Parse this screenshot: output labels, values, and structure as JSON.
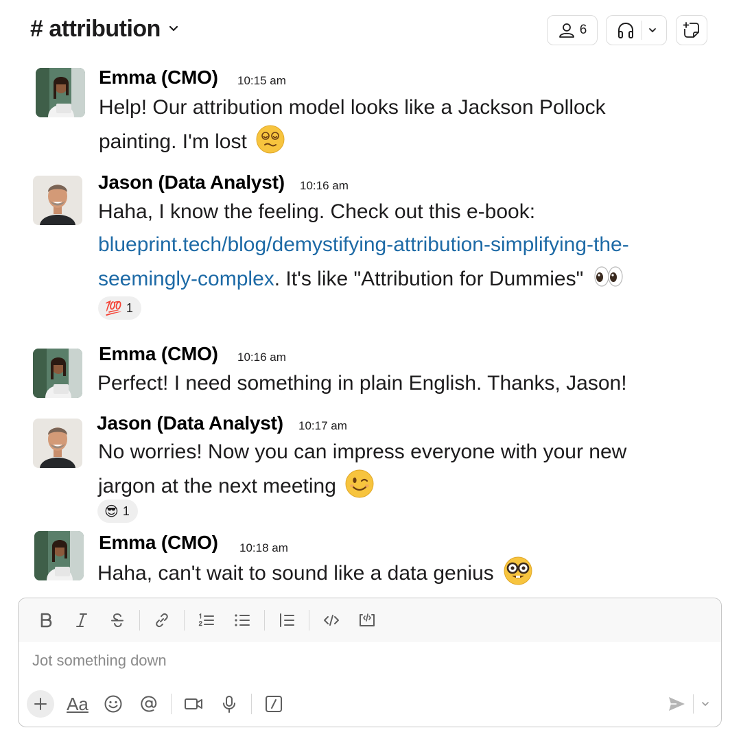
{
  "header": {
    "channel_title": "# attribution",
    "member_count": "6"
  },
  "messages": [
    {
      "sender": "Emma (CMO)",
      "time": "10:15 am",
      "lines": [
        "Help! Our attribution model looks like a Jackson Pollock",
        "painting. I'm lost"
      ],
      "emoji": "dizzy-face"
    },
    {
      "sender": "Jason (Data Analyst)",
      "time": "10:16 am",
      "line1": "Haha, I know the feeling. Check out this e-book:",
      "link_line1": "blueprint.tech/blog/demystifying-attribution-simplifying-the-",
      "link_line2": "seemingly-complex",
      "line3_rest": ". It's like \"Attribution for Dummies\"",
      "emoji": "eyes",
      "reaction": {
        "emoji": "💯",
        "count": "1"
      }
    },
    {
      "sender": "Emma (CMO)",
      "time": "10:16 am",
      "lines": [
        "Perfect! I need something in plain English. Thanks, Jason!"
      ]
    },
    {
      "sender": "Jason (Data Analyst)",
      "time": "10:17 am",
      "lines": [
        "No worries! Now you can impress everyone with your new",
        "jargon at the next meeting"
      ],
      "emoji": "winking-face",
      "reaction": {
        "emoji": "😎",
        "count": "1"
      }
    },
    {
      "sender": "Emma (CMO)",
      "time": "10:18 am",
      "lines": [
        "Haha, can't wait to sound like a data genius"
      ],
      "emoji": "nerd-face"
    }
  ],
  "composer": {
    "placeholder": "Jot something down",
    "format_label": "Aa"
  },
  "colors": {
    "link": "#1d6aa6",
    "text": "#1d1c1d",
    "border": "#c6c6c6",
    "emoji_yellow": "#f7c43e"
  }
}
